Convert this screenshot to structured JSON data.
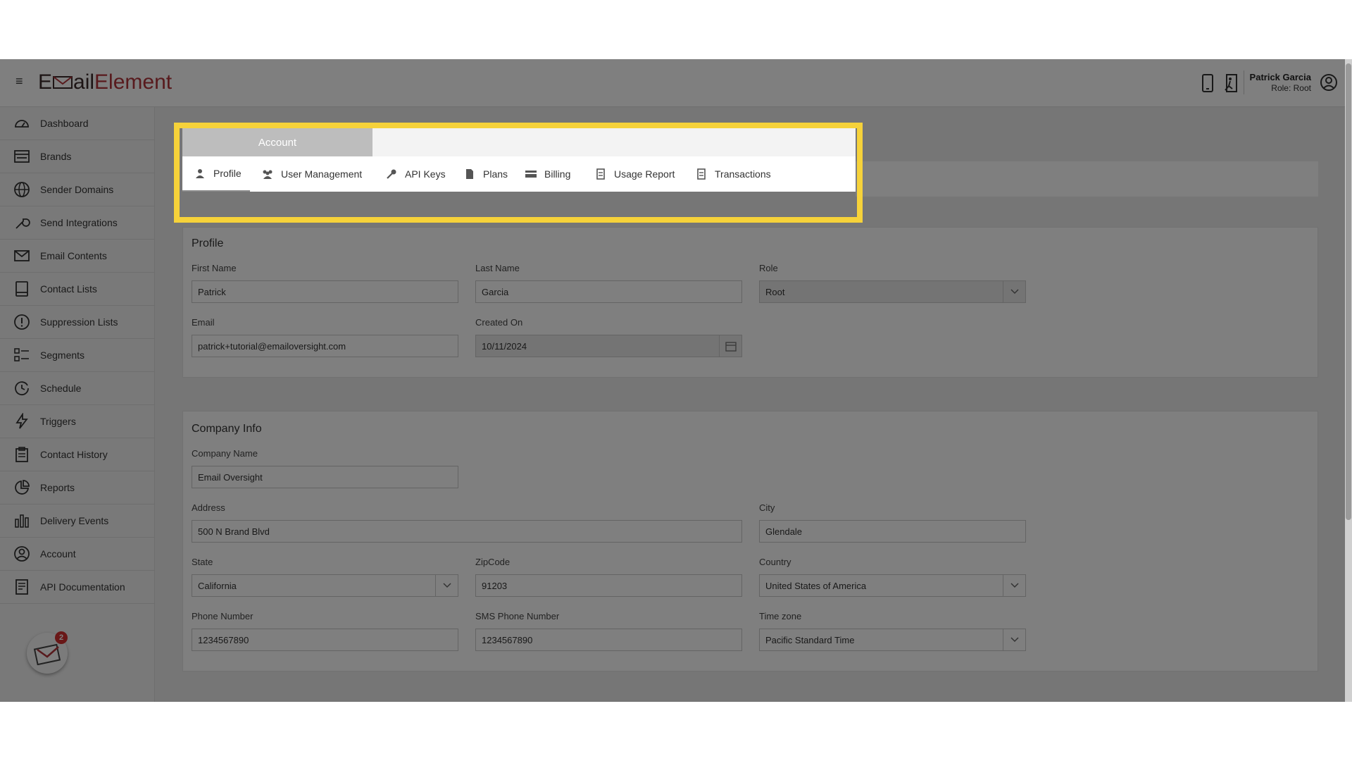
{
  "app": {
    "logo_part1": "E",
    "logo_part2": "ail",
    "logo_part3": "Element"
  },
  "header": {
    "user_name": "Patrick Garcia",
    "user_role": "Role: Root",
    "icons": [
      "phone-icon",
      "exit-icon",
      "user-circle-icon"
    ]
  },
  "sidebar": {
    "items": [
      {
        "label": "Dashboard",
        "icon": "gauge-icon"
      },
      {
        "label": "Brands",
        "icon": "brands-icon"
      },
      {
        "label": "Sender Domains",
        "icon": "globe-icon"
      },
      {
        "label": "Send Integrations",
        "icon": "wrench-icon"
      },
      {
        "label": "Email Contents",
        "icon": "envelope-icon"
      },
      {
        "label": "Contact Lists",
        "icon": "book-icon"
      },
      {
        "label": "Suppression Lists",
        "icon": "alert-circle-icon"
      },
      {
        "label": "Segments",
        "icon": "segments-icon"
      },
      {
        "label": "Schedule",
        "icon": "clock-icon"
      },
      {
        "label": "Triggers",
        "icon": "bolt-icon"
      },
      {
        "label": "Contact History",
        "icon": "clipboard-icon"
      },
      {
        "label": "Reports",
        "icon": "pie-chart-icon"
      },
      {
        "label": "Delivery Events",
        "icon": "bar-chart-icon"
      },
      {
        "label": "Account",
        "icon": "account-circle-icon"
      },
      {
        "label": "API Documentation",
        "icon": "document-icon"
      }
    ],
    "chat_badge": "2"
  },
  "tabs": {
    "main_tab": "Account",
    "subtabs": [
      {
        "label": "Profile",
        "icon": "person-icon",
        "active": true
      },
      {
        "label": "User Management",
        "icon": "users-icon",
        "active": false
      },
      {
        "label": "API Keys",
        "icon": "key-icon",
        "active": false
      },
      {
        "label": "Plans",
        "icon": "plans-icon",
        "active": false
      },
      {
        "label": "Billing",
        "icon": "credit-card-icon",
        "active": false
      },
      {
        "label": "Usage Report",
        "icon": "report-icon",
        "active": false
      },
      {
        "label": "Transactions",
        "icon": "receipt-icon",
        "active": false
      }
    ]
  },
  "profile": {
    "title": "Profile",
    "first_name_label": "First Name",
    "first_name": "Patrick",
    "last_name_label": "Last Name",
    "last_name": "Garcia",
    "role_label": "Role",
    "role": "Root",
    "email_label": "Email",
    "email": "patrick+tutorial@emailoversight.com",
    "created_label": "Created On",
    "created": "10/11/2024"
  },
  "company": {
    "title": "Company Info",
    "name_label": "Company Name",
    "name": "Email Oversight",
    "address_label": "Address",
    "address": "500 N Brand Blvd",
    "city_label": "City",
    "city": "Glendale",
    "state_label": "State",
    "state": "California",
    "zip_label": "ZipCode",
    "zip": "91203",
    "country_label": "Country",
    "country": "United States of America",
    "phone_label": "Phone Number",
    "phone": "1234567890",
    "sms_label": "SMS Phone Number",
    "sms": "1234567890",
    "tz_label": "Time zone",
    "tz": "Pacific Standard Time"
  },
  "colors": {
    "highlight": "#f6d23a",
    "logo_red": "#b0343a",
    "badge": "#d32f2f"
  }
}
